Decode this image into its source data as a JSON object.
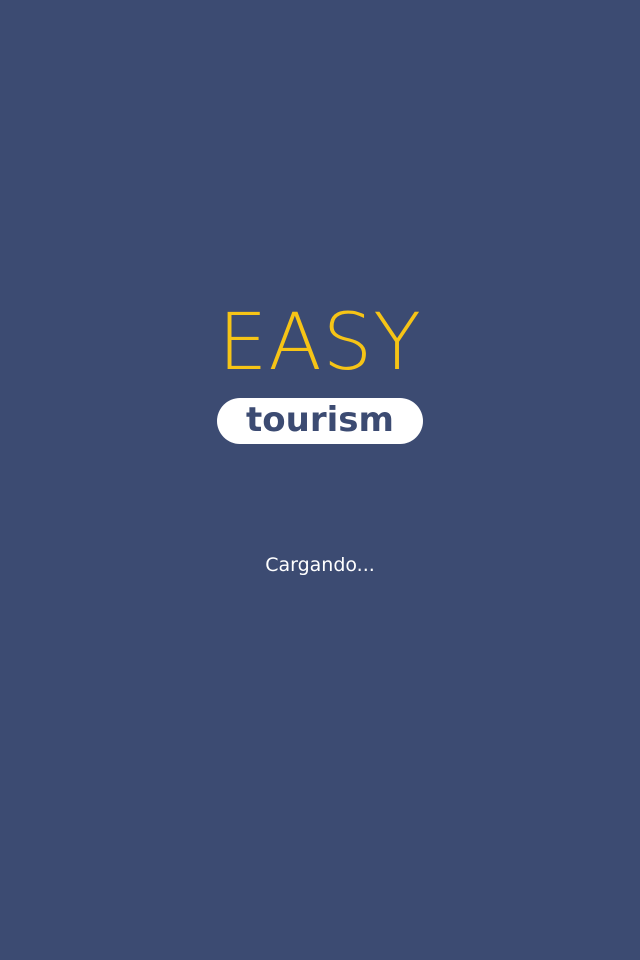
{
  "logo": {
    "title": "EASY",
    "subtitle": "tourism"
  },
  "status": {
    "loading_text": "Cargando..."
  },
  "colors": {
    "background": "#3c4b72",
    "accent": "#f6c416",
    "pill": "#ffffff"
  }
}
